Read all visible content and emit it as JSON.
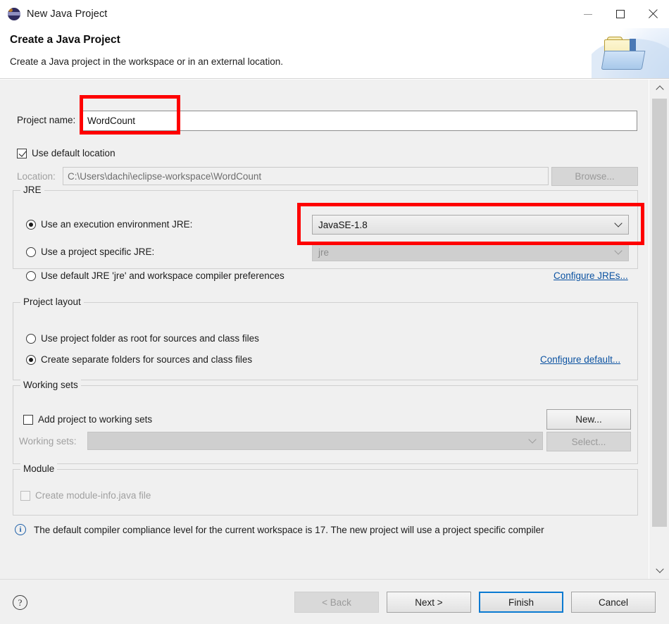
{
  "window": {
    "title": "New Java Project",
    "icon": "eclipse-icon",
    "controls": {
      "minimize": "minimize",
      "maximize": "maximize",
      "close": "close"
    }
  },
  "banner": {
    "title": "Create a Java Project",
    "subtitle": "Create a Java project in the workspace or in an external location.",
    "icon": "new-java-project-folder-icon"
  },
  "form": {
    "project_name": {
      "label": "Project name:",
      "value": "WordCount",
      "placeholder": ""
    },
    "use_default_location": {
      "label": "Use default location",
      "checked": true
    },
    "location": {
      "label": "Location:",
      "value": "C:\\Users\\dachi\\eclipse-workspace\\WordCount",
      "browse_label": "Browse...",
      "enabled": false
    }
  },
  "jre_group": {
    "legend": "JRE",
    "options": [
      {
        "label": "Use an execution environment JRE:",
        "selected": true
      },
      {
        "label": "Use a project specific JRE:",
        "selected": false
      },
      {
        "label": "Use default JRE 'jre' and workspace compiler preferences",
        "selected": false
      }
    ],
    "execution_environment": {
      "value": "JavaSE-1.8",
      "enabled": true
    },
    "project_jre": {
      "value": "jre",
      "enabled": false
    },
    "configure_link": "Configure JREs..."
  },
  "layout_group": {
    "legend": "Project layout",
    "options": [
      {
        "label": "Use project folder as root for sources and class files",
        "selected": false
      },
      {
        "label": "Create separate folders for sources and class files",
        "selected": true
      }
    ],
    "configure_link": "Configure default..."
  },
  "working_sets_group": {
    "legend": "Working sets",
    "add_checkbox": {
      "label": "Add project to working sets",
      "checked": false
    },
    "new_button": "New...",
    "working_sets_label": "Working sets:",
    "working_sets_value": "",
    "select_button": "Select..."
  },
  "module_group": {
    "legend": "Module",
    "create_module_info": {
      "label": "Create module-info.java file",
      "checked": false,
      "enabled": false
    }
  },
  "status": {
    "icon": "info-icon",
    "message": "The default compiler compliance level for the current workspace is 17. The new project will use a project specific compiler"
  },
  "footer": {
    "help": "?",
    "buttons": [
      {
        "label": "< Back",
        "enabled": false,
        "default": false
      },
      {
        "label": "Next >",
        "enabled": true,
        "default": false
      },
      {
        "label": "Finish",
        "enabled": true,
        "default": true
      },
      {
        "label": "Cancel",
        "enabled": true,
        "default": false
      }
    ]
  },
  "annotations": [
    {
      "name": "project-name-highlight",
      "color": "#fe0000"
    },
    {
      "name": "execution-environment-highlight",
      "color": "#fe0000"
    }
  ],
  "scrollbar": {
    "position": "right",
    "up": "chevron-up",
    "down": "chevron-down"
  }
}
